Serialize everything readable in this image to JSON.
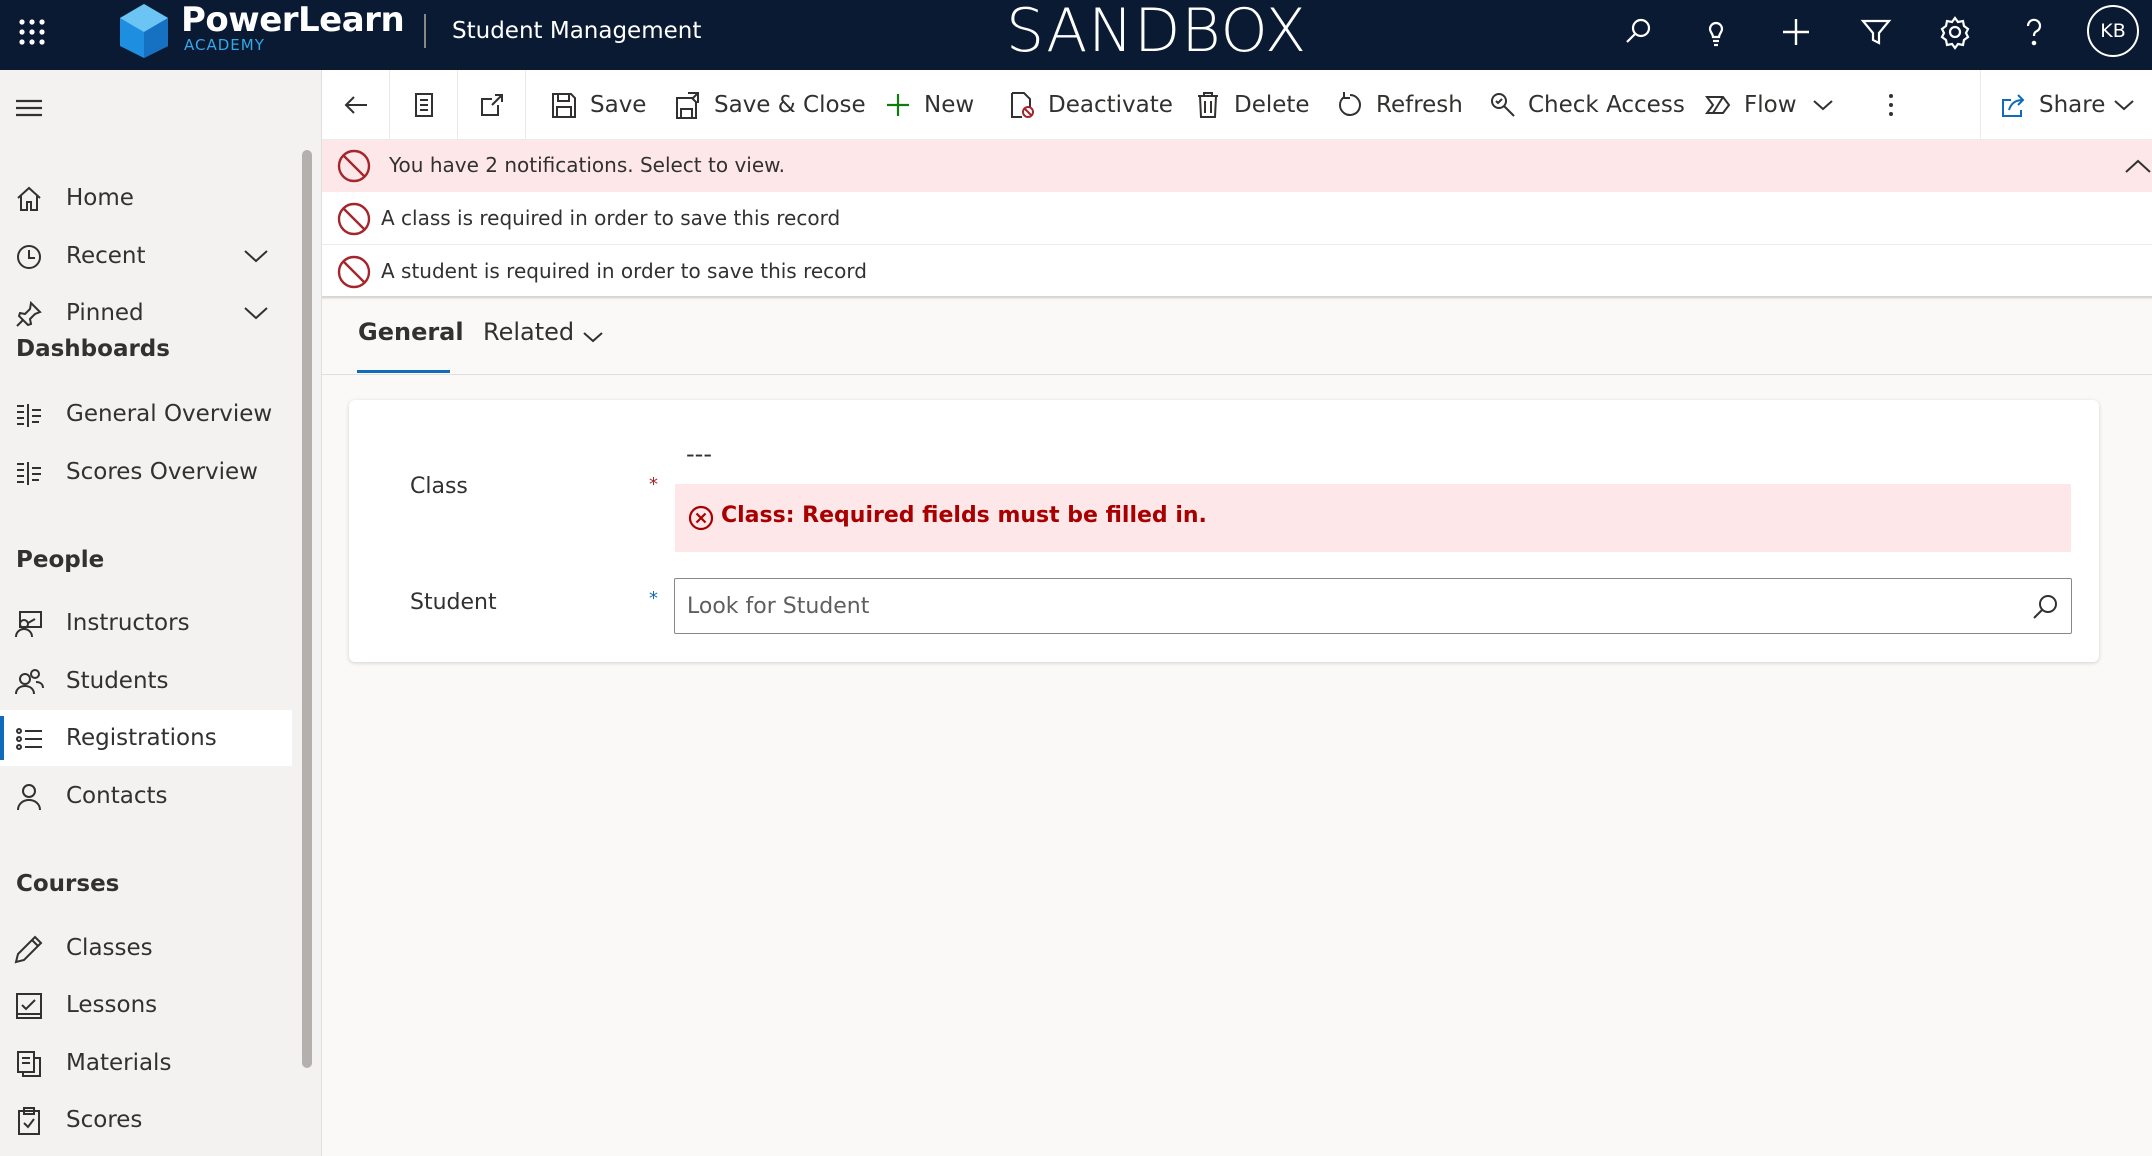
{
  "topbar": {
    "brand_name": "PowerLearn",
    "brand_sub": "ACADEMY",
    "app_name": "Student Management",
    "environment": "SANDBOX",
    "avatar_initials": "KB",
    "icons": [
      "waffle-icon",
      "search-icon",
      "lightbulb-icon",
      "plus-icon",
      "filter-icon",
      "settings-icon",
      "help-icon"
    ]
  },
  "sidebar": {
    "top_items": [
      {
        "label": "Home",
        "icon": "home-icon"
      },
      {
        "label": "Recent",
        "icon": "clock-icon",
        "expandable": true
      },
      {
        "label": "Pinned",
        "icon": "pin-icon",
        "expandable": true
      }
    ],
    "groups": [
      {
        "title": "Dashboards",
        "items": [
          {
            "label": "General Overview",
            "icon": "dashboard-icon"
          },
          {
            "label": "Scores Overview",
            "icon": "dashboard-icon"
          }
        ]
      },
      {
        "title": "People",
        "items": [
          {
            "label": "Instructors",
            "icon": "instructor-icon"
          },
          {
            "label": "Students",
            "icon": "students-icon"
          },
          {
            "label": "Registrations",
            "icon": "list-icon",
            "selected": true
          },
          {
            "label": "Contacts",
            "icon": "person-icon"
          }
        ]
      },
      {
        "title": "Courses",
        "items": [
          {
            "label": "Classes",
            "icon": "pencil-icon"
          },
          {
            "label": "Lessons",
            "icon": "checklist-icon"
          },
          {
            "label": "Materials",
            "icon": "copy-icon"
          },
          {
            "label": "Scores",
            "icon": "clipboard-icon"
          }
        ]
      }
    ]
  },
  "commandbar": {
    "save": "Save",
    "save_close": "Save & Close",
    "new": "New",
    "deactivate": "Deactivate",
    "delete": "Delete",
    "refresh": "Refresh",
    "check_access": "Check Access",
    "flow": "Flow",
    "share": "Share"
  },
  "notifications": {
    "summary": "You have 2 notifications. Select to view.",
    "items": [
      "A class is required in order to save this record",
      "A student is required in order to save this record"
    ]
  },
  "tabs": {
    "general": "General",
    "related": "Related"
  },
  "form": {
    "class_label": "Class",
    "class_value": "---",
    "required_mark": "*",
    "class_error": "Class: Required fields must be filled in.",
    "student_label": "Student",
    "student_placeholder": "Look for Student",
    "student_value": ""
  },
  "colors": {
    "topbar_bg": "#0b1a33",
    "accent": "#0f6cbd",
    "error": "#a80000",
    "error_bg": "#fde7e9"
  }
}
